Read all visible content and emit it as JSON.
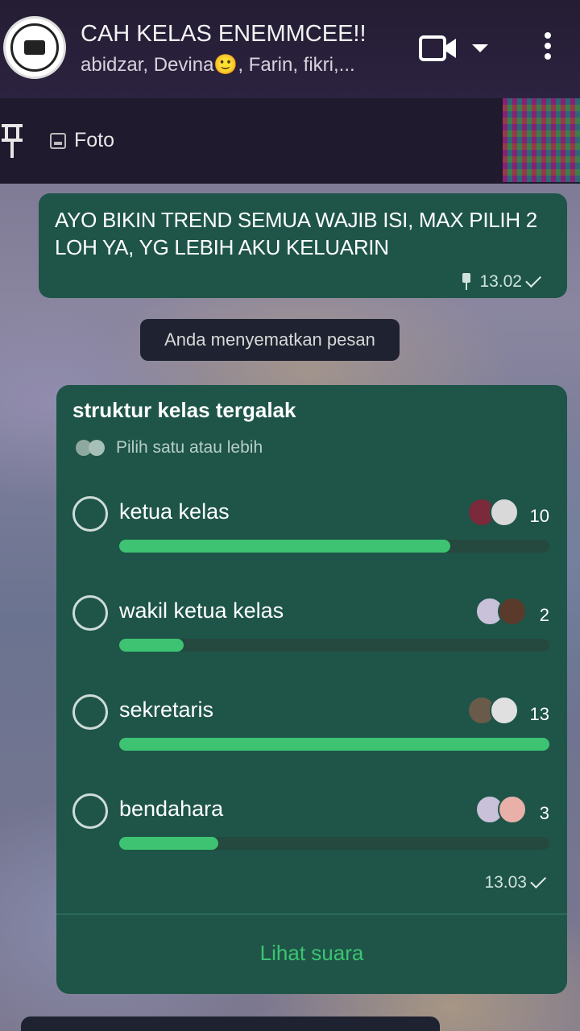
{
  "header": {
    "title": "CAH KELAS ENEMMCEE!!",
    "subtitle": "abidzar, Devina🙂, Farin, fikri,..."
  },
  "pinned": {
    "label": "Foto"
  },
  "message": {
    "text": "AYO BIKIN TREND SEMUA WAJIB ISI, MAX PILIH 2 LOH YA, YG LEBIH AKU KELUARIN",
    "time": "13.02"
  },
  "system": {
    "text": "Anda menyematkan pesan"
  },
  "poll": {
    "question": "struktur kelas tergalak",
    "hint": "Pilih satu atau lebih",
    "options": [
      {
        "label": "ketua kelas",
        "votes": "10",
        "share": 0.77
      },
      {
        "label": "wakil ketua kelas",
        "votes": "2",
        "share": 0.15
      },
      {
        "label": "sekretaris",
        "votes": "13",
        "share": 1.0
      },
      {
        "label": "bendahara",
        "votes": "3",
        "share": 0.23
      }
    ],
    "time": "13.03",
    "see_votes": "Lihat suara"
  },
  "colors": {
    "bubble": "#1e5548",
    "accent": "#3dc372"
  }
}
